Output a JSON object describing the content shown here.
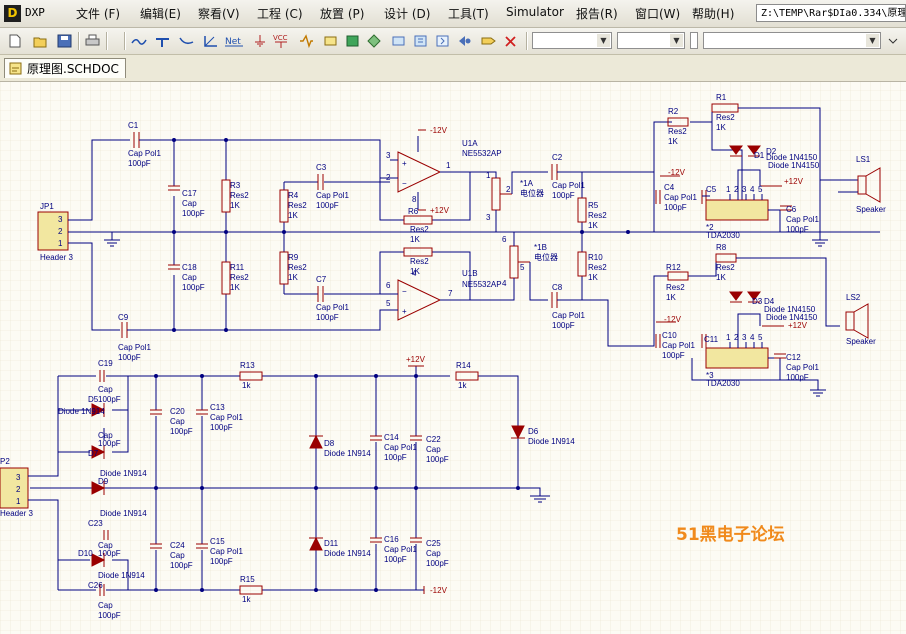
{
  "app": {
    "logo_text": "DXP",
    "path": "Z:\\TEMP\\Rar$DIa0.334\\原理图"
  },
  "menu": [
    {
      "label": "文件 (F)"
    },
    {
      "label": "编辑(E)"
    },
    {
      "label": "察看(V)"
    },
    {
      "label": "工程 (C)"
    },
    {
      "label": "放置 (P)"
    },
    {
      "label": "设计 (D)"
    },
    {
      "label": "工具(T)"
    },
    {
      "label": "Simulator"
    },
    {
      "label": "报告(R)"
    },
    {
      "label": "窗口(W)"
    },
    {
      "label": "帮助(H)"
    }
  ],
  "toolbar": {
    "combo1": "",
    "combo2": "",
    "combo3": "",
    "combo4": ""
  },
  "tab": {
    "label": "原理图.SCHDOC"
  },
  "watermark": "51黑电子论坛",
  "colors": {
    "wire": "#000080",
    "part": "#9a0000",
    "watermark": "#f08a1c",
    "sheet": "#fcfbf4"
  },
  "schematic": {
    "jp1": {
      "designator": "JP1",
      "comment": "Header 3",
      "pins": [
        "3",
        "2",
        "1"
      ]
    },
    "p2": {
      "designator": "P2",
      "comment": "Header 3",
      "pins": [
        "3",
        "2",
        "1"
      ]
    },
    "c1": {
      "designator": "C1",
      "comment": "Cap Pol1",
      "value": "100pF"
    },
    "c9": {
      "designator": "C9",
      "comment": "Cap Pol1",
      "value": "100pF"
    },
    "c17": {
      "designator": "C17",
      "comment": "Cap",
      "value": "100pF"
    },
    "c18": {
      "designator": "C18",
      "comment": "Cap",
      "value": "100pF"
    },
    "r3": {
      "designator": "R3",
      "comment": "Res2",
      "value": "1K"
    },
    "r11": {
      "designator": "R11",
      "comment": "Res2",
      "value": "1K"
    },
    "r4": {
      "designator": "R4",
      "comment": "Res2",
      "value": "1K"
    },
    "r9": {
      "designator": "R9",
      "comment": "Res2",
      "value": "1K"
    },
    "c3": {
      "designator": "C3",
      "comment": "Cap Pol1",
      "value": "100pF"
    },
    "c7": {
      "designator": "C7",
      "comment": "Cap Pol1",
      "value": "100pF"
    },
    "u1a": {
      "designator": "U1A",
      "comment": "NE5532AP",
      "pins": [
        "3",
        "2",
        "1",
        "8"
      ]
    },
    "u1b": {
      "designator": "U1B",
      "comment": "NE5532AP",
      "pins": [
        "6",
        "5",
        "7",
        "4"
      ]
    },
    "rf1": {
      "designator": "R6",
      "comment": "Res2",
      "value": "1K"
    },
    "rf2": {
      "designator": "R8",
      "comment": "Res2",
      "value": "1K"
    },
    "vr1a": {
      "designator": "*1A",
      "comment": "电位器",
      "pins": [
        "1",
        "2",
        "3"
      ]
    },
    "vr1b": {
      "designator": "*1B",
      "comment": "电位器",
      "pins": [
        "6",
        "5",
        "4"
      ]
    },
    "c2": {
      "designator": "C2",
      "comment": "Cap Pol1",
      "value": "100pF"
    },
    "c8": {
      "designator": "C8",
      "comment": "Cap Pol1",
      "value": "100pF"
    },
    "r5": {
      "designator": "R5",
      "comment": "Res2",
      "value": "1K"
    },
    "r10": {
      "designator": "R10",
      "comment": "Res2",
      "value": "1K"
    },
    "r1": {
      "designator": "R1",
      "comment": "Res2",
      "value": "1K"
    },
    "r2": {
      "designator": "R2",
      "comment": "Res2",
      "value": "1K"
    },
    "r8b": {
      "designator": "R8",
      "comment": "Res2",
      "value": "1K"
    },
    "r12": {
      "designator": "R12",
      "comment": "Res2",
      "value": "1K"
    },
    "d1": {
      "designator": "D1",
      "comment": "Diode 1N4150"
    },
    "d2": {
      "designator": "D2",
      "comment": "Diode 1N4150"
    },
    "d3": {
      "designator": "D3",
      "comment": "Diode 1N4150"
    },
    "d4": {
      "designator": "D4",
      "comment": "Diode 1N4150"
    },
    "c4": {
      "designator": "C4",
      "comment": "Cap Pol1",
      "value": "100pF"
    },
    "c5": {
      "designator": "C5",
      "comment": "Cap Pol1",
      "value": "100pF"
    },
    "c6": {
      "designator": "C6",
      "comment": "Cap Pol1",
      "value": "100pF"
    },
    "c10": {
      "designator": "C10",
      "comment": "Cap Pol1",
      "value": "100pF"
    },
    "c11": {
      "designator": "C11",
      "comment": "Cap Pol1",
      "value": "100pF"
    },
    "c12": {
      "designator": "C12",
      "comment": "Cap Pol1",
      "value": "100pF"
    },
    "amp1": {
      "designator": "*2",
      "comment": "TDA2030",
      "pins": [
        "1",
        "2",
        "3",
        "4",
        "5"
      ]
    },
    "amp2": {
      "designator": "*3",
      "comment": "TDA2030",
      "pins": [
        "1",
        "2",
        "3",
        "4",
        "5"
      ]
    },
    "ls1": {
      "designator": "LS1",
      "comment": "Speaker"
    },
    "ls2": {
      "designator": "LS2",
      "comment": "Speaker"
    },
    "c19": {
      "designator": "C19",
      "comment": "Cap",
      "value": "100pF"
    },
    "c23": {
      "designator": "C23",
      "comment": "Cap",
      "value": "100pF"
    },
    "c26": {
      "designator": "C26",
      "comment": "Cap",
      "value": "100pF"
    },
    "d5": {
      "designator": "D5",
      "comment": "Diode 1N914"
    },
    "d7": {
      "designator": "D7",
      "comment": "Diode 1N914"
    },
    "d9": {
      "designator": "D9",
      "comment": "Diode 1N914"
    },
    "d10": {
      "designator": "D10",
      "comment": "Diode 1N914"
    },
    "c20": {
      "designator": "C20",
      "comment": "Cap",
      "value": "100pF"
    },
    "c24": {
      "designator": "C24",
      "comment": "Cap",
      "value": "100pF"
    },
    "c13": {
      "designator": "C13",
      "comment": "Cap Pol1",
      "value": "100pF"
    },
    "c15": {
      "designator": "C15",
      "comment": "Cap Pol1",
      "value": "100pF"
    },
    "r13": {
      "designator": "R13",
      "value": "1k"
    },
    "r15": {
      "designator": "R15",
      "value": "1k"
    },
    "r14": {
      "designator": "R14",
      "value": "1k"
    },
    "d8": {
      "designator": "D8",
      "comment": "Diode 1N914"
    },
    "d11": {
      "designator": "D11",
      "comment": "Diode 1N914"
    },
    "d6": {
      "designator": "D6",
      "comment": "Diode 1N914"
    },
    "c14": {
      "designator": "C14",
      "comment": "Cap Pol1",
      "value": "100pF"
    },
    "c16": {
      "designator": "C16",
      "comment": "Cap Pol1",
      "value": "100pF"
    },
    "c22": {
      "designator": "C22",
      "comment": "Cap",
      "value": "100pF"
    },
    "c25": {
      "designator": "C25",
      "comment": "Cap",
      "value": "100pF"
    },
    "power": {
      "pos": "+12V",
      "neg": "-12V"
    }
  }
}
